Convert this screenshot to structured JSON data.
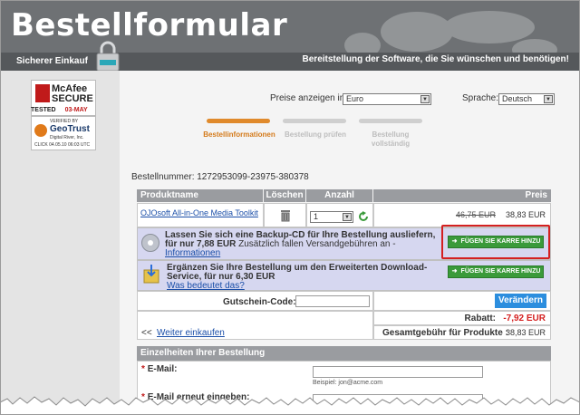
{
  "header": {
    "title": "Bestellformular",
    "subtitle": "Bereitstellung der Software, die Sie wünschen und benötigen!",
    "secure_label": "Sicherer Einkauf"
  },
  "badges": {
    "mcafee": {
      "line1": "McAfee",
      "line2": "SECURE",
      "tested": "TESTED",
      "date": "03-MAY"
    },
    "geotrust": {
      "verified": "VERIFIED BY",
      "name": "GeoTrust",
      "company": "Digital River, Inc.",
      "click": "CLICK 04.05.10 06:03 UTC"
    }
  },
  "settings": {
    "price_label": "Preise anzeigen in:",
    "currency": "Euro",
    "language_label": "Sprache:",
    "language": "Deutsch"
  },
  "steps": [
    {
      "label": "Bestellinformationen",
      "active": true
    },
    {
      "label": "Bestellung prüfen",
      "active": false
    },
    {
      "label": "Bestellung vollständig",
      "active": false
    }
  ],
  "order": {
    "number_label": "Bestellnummer:",
    "number": "1272953099-23975-380378"
  },
  "table": {
    "headers": {
      "product": "Produktname",
      "delete": "Löschen",
      "qty": "Anzahl",
      "price": "Preis"
    },
    "item": {
      "name": "OJOsoft All-in-One Media Toolkit",
      "qty": "1",
      "old_price": "46,75 EUR",
      "price": "38,83 EUR"
    }
  },
  "offers": {
    "backup": {
      "text1": "Lassen Sie sich eine Backup-CD für Ihre Bestellung ausliefern,",
      "text2_bold": "für nur 7,88 EUR",
      "text2_rest": " Zusätzlich fallen Versandgebühren an -",
      "link": "Informationen",
      "button": "FÜGEN SIE KARRE HINZU"
    },
    "download": {
      "text1": "Ergänzen Sie Ihre Bestellung um den Erweiterten Download-",
      "text2": "Service, für nur 6,30 EUR",
      "link": "Was bedeutet das?",
      "button": "FÜGEN SIE KARRE HINZU"
    }
  },
  "coupon": {
    "label": "Gutschein-Code:",
    "value": "",
    "update_button": "Verändern",
    "discount_label": "Rabatt:",
    "discount": "-7,92 EUR",
    "total_label": "Gesamtgebühr für Produkte :",
    "total": "38,83 EUR",
    "continue_prefix": "<<",
    "continue_link": "Weiter einkaufen"
  },
  "details": {
    "heading": "Einzelheiten Ihrer Bestellung",
    "email_label": "E-Mail:",
    "email_example": "Beispiel: jon@acme.com",
    "email_repeat_label": "E-Mail erneut eingeben:"
  },
  "colors": {
    "header_bg": "#6e7174",
    "accent_orange": "#e08a2c",
    "button_green": "#3a9a3a",
    "button_blue": "#2c8ede",
    "discount_red": "#d42020",
    "highlight_red": "#d42020"
  }
}
